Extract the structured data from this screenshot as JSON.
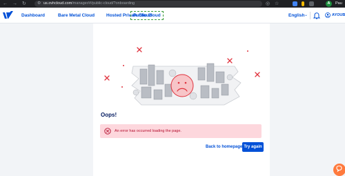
{
  "browser": {
    "url_host": "us.ovhcloud.com",
    "url_path": "/manager/#/public-cloud/?onboarding",
    "avatar_letter": "A",
    "profile_text": "Pau"
  },
  "header": {
    "menu": [
      {
        "label": "Dashboard",
        "active": false
      },
      {
        "label": "Bare Metal Cloud",
        "active": false
      },
      {
        "label": "Hosted Private Cloud",
        "active": false
      },
      {
        "label": "Public Cloud",
        "active": true
      }
    ],
    "language": "English",
    "account_label": "AYOUB N"
  },
  "main": {
    "title": "Oops!",
    "error_message": "An error has occurred loading the page.",
    "back_link": "Back to homepage",
    "try_again": "Try again"
  },
  "colors": {
    "brand": "#0050d7",
    "error_bg": "#fdd7dd",
    "error_text": "#b30c2c",
    "chat": "#ff7a3d"
  }
}
